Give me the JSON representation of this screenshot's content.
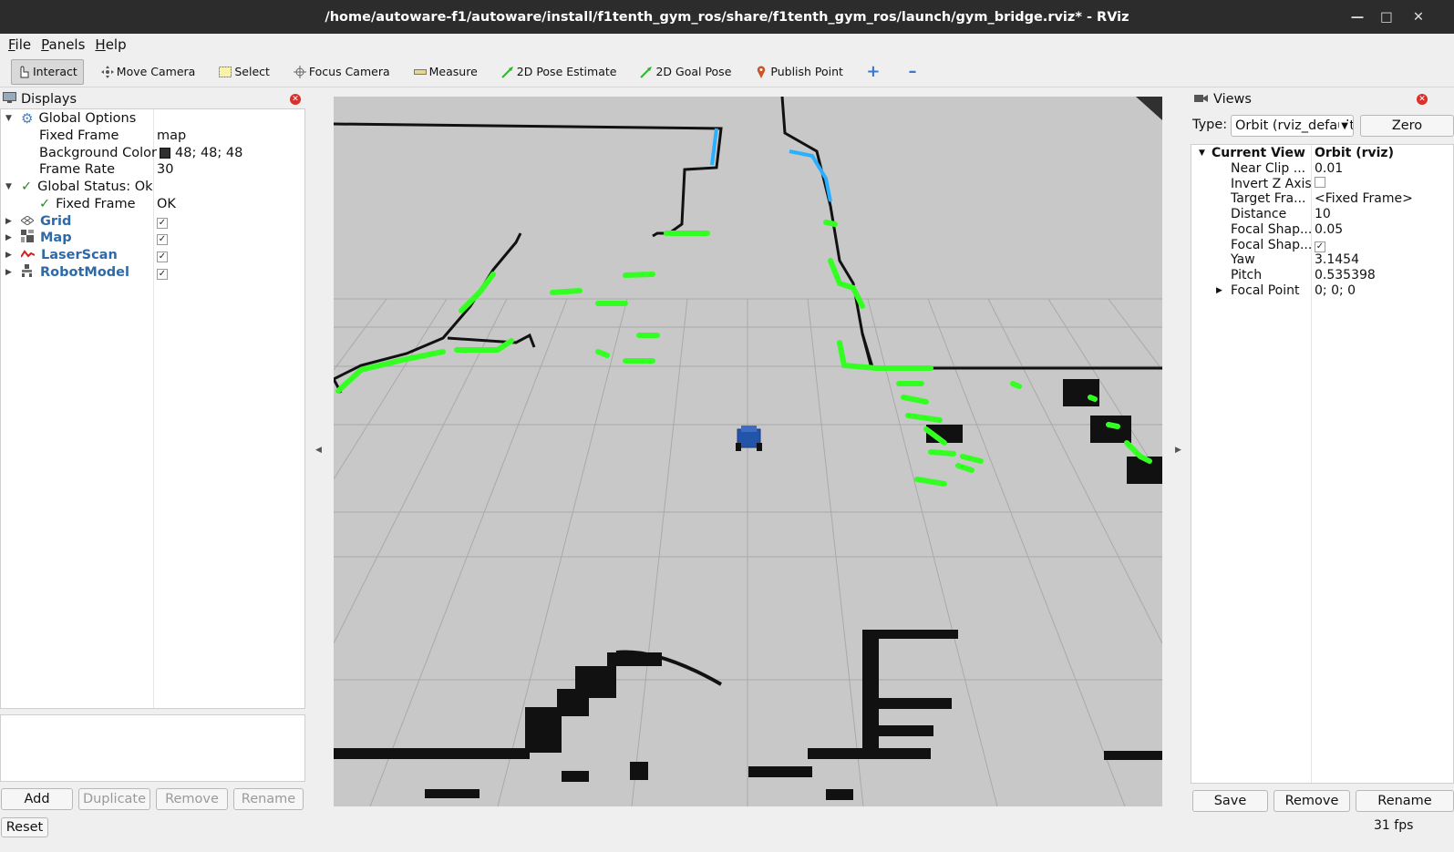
{
  "window": {
    "title": "/home/autoware-f1/autoware/install/f1tenth_gym_ros/share/f1tenth_gym_ros/launch/gym_bridge.rviz* - RViz"
  },
  "menu": [
    "File",
    "Panels",
    "Help"
  ],
  "toolbar": {
    "tools": [
      {
        "label": "Interact",
        "icon": "hand-pointer-icon",
        "active": true
      },
      {
        "label": "Move Camera",
        "icon": "move-camera-icon"
      },
      {
        "label": "Select",
        "icon": "select-rectangle-icon"
      },
      {
        "label": "Focus Camera",
        "icon": "focus-camera-icon"
      },
      {
        "label": "Measure",
        "icon": "ruler-icon"
      },
      {
        "label": "2D Pose Estimate",
        "icon": "green-arrow-icon"
      },
      {
        "label": "2D Goal Pose",
        "icon": "green-arrow-icon"
      },
      {
        "label": "Publish Point",
        "icon": "map-pin-icon"
      }
    ]
  },
  "displays": {
    "title": "Displays",
    "rows": [
      {
        "label": "Global Options",
        "value": "",
        "icon": "gear-icon",
        "expanded": true
      },
      {
        "label": "Fixed Frame",
        "value": "map"
      },
      {
        "label": "Background Color",
        "value": "48; 48; 48",
        "swatch": "#303030"
      },
      {
        "label": "Frame Rate",
        "value": "30"
      },
      {
        "label": "Global Status: Ok",
        "value": "",
        "icon": "check-icon",
        "expanded": true
      },
      {
        "label": "Fixed Frame",
        "value": "OK",
        "icon": "check-icon"
      },
      {
        "label": "Grid",
        "checked": true,
        "icon": "grid-icon"
      },
      {
        "label": "Map",
        "checked": true,
        "icon": "map-icon"
      },
      {
        "label": "LaserScan",
        "checked": true,
        "icon": "laserscan-icon"
      },
      {
        "label": "RobotModel",
        "checked": true,
        "icon": "robot-model-icon"
      }
    ],
    "buttons": [
      "Add",
      "Duplicate",
      "Remove",
      "Rename"
    ]
  },
  "views": {
    "title": "Views",
    "type_label": "Type:",
    "type_value": "Orbit (rviz_default_plugins)",
    "zero_label": "Zero",
    "current_view": {
      "label": "Current View",
      "value": "Orbit (rviz)"
    },
    "props": [
      {
        "label": "Near Clip ...",
        "value": "0.01"
      },
      {
        "label": "Invert Z Axis",
        "value": "",
        "checkbox": false
      },
      {
        "label": "Target Fra...",
        "value": "<Fixed Frame>"
      },
      {
        "label": "Distance",
        "value": "10"
      },
      {
        "label": "Focal Shap...",
        "value": "0.05"
      },
      {
        "label": "Focal Shap...",
        "value": "",
        "checkbox": true
      },
      {
        "label": "Yaw",
        "value": "3.1454"
      },
      {
        "label": "Pitch",
        "value": "0.535398"
      },
      {
        "label": "Focal Point",
        "value": "0; 0; 0",
        "collapsed": true
      }
    ],
    "buttons": [
      "Save",
      "Remove",
      "Rename"
    ]
  },
  "status": {
    "reset_label": "Reset",
    "fps": "31 fps"
  },
  "colors": {
    "background": "#303030",
    "map_floor": "#c8c8c8",
    "laser": "#33ff22",
    "robot": "#2255aa"
  }
}
